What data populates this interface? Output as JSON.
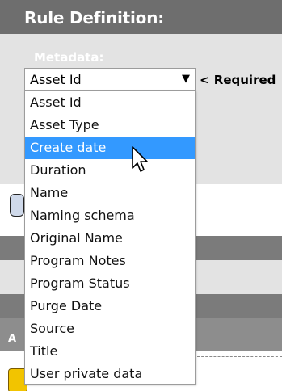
{
  "section": {
    "title": "Rule Definition:"
  },
  "metadata": {
    "label": "Metadata:",
    "selected_value": "Asset Id",
    "dropdown_arrow_icon": "triangle-down-icon",
    "required_note": "< Required",
    "options": [
      "Asset Id",
      "Asset Type",
      "Create date",
      "Duration",
      "Name",
      "Naming schema",
      "Original Name",
      "Program Notes",
      "Program Status",
      "Purge Date",
      "Source",
      "Title",
      "User private data"
    ],
    "highlighted_option": "Create date"
  },
  "background": {
    "partial_text": "A"
  },
  "colors": {
    "highlight": "#3399ff",
    "header": "#6e6e6e",
    "panel": "#e3e3e3",
    "band": "#7b7b7b"
  },
  "icons": {
    "cursor": "mouse-pointer-icon"
  }
}
